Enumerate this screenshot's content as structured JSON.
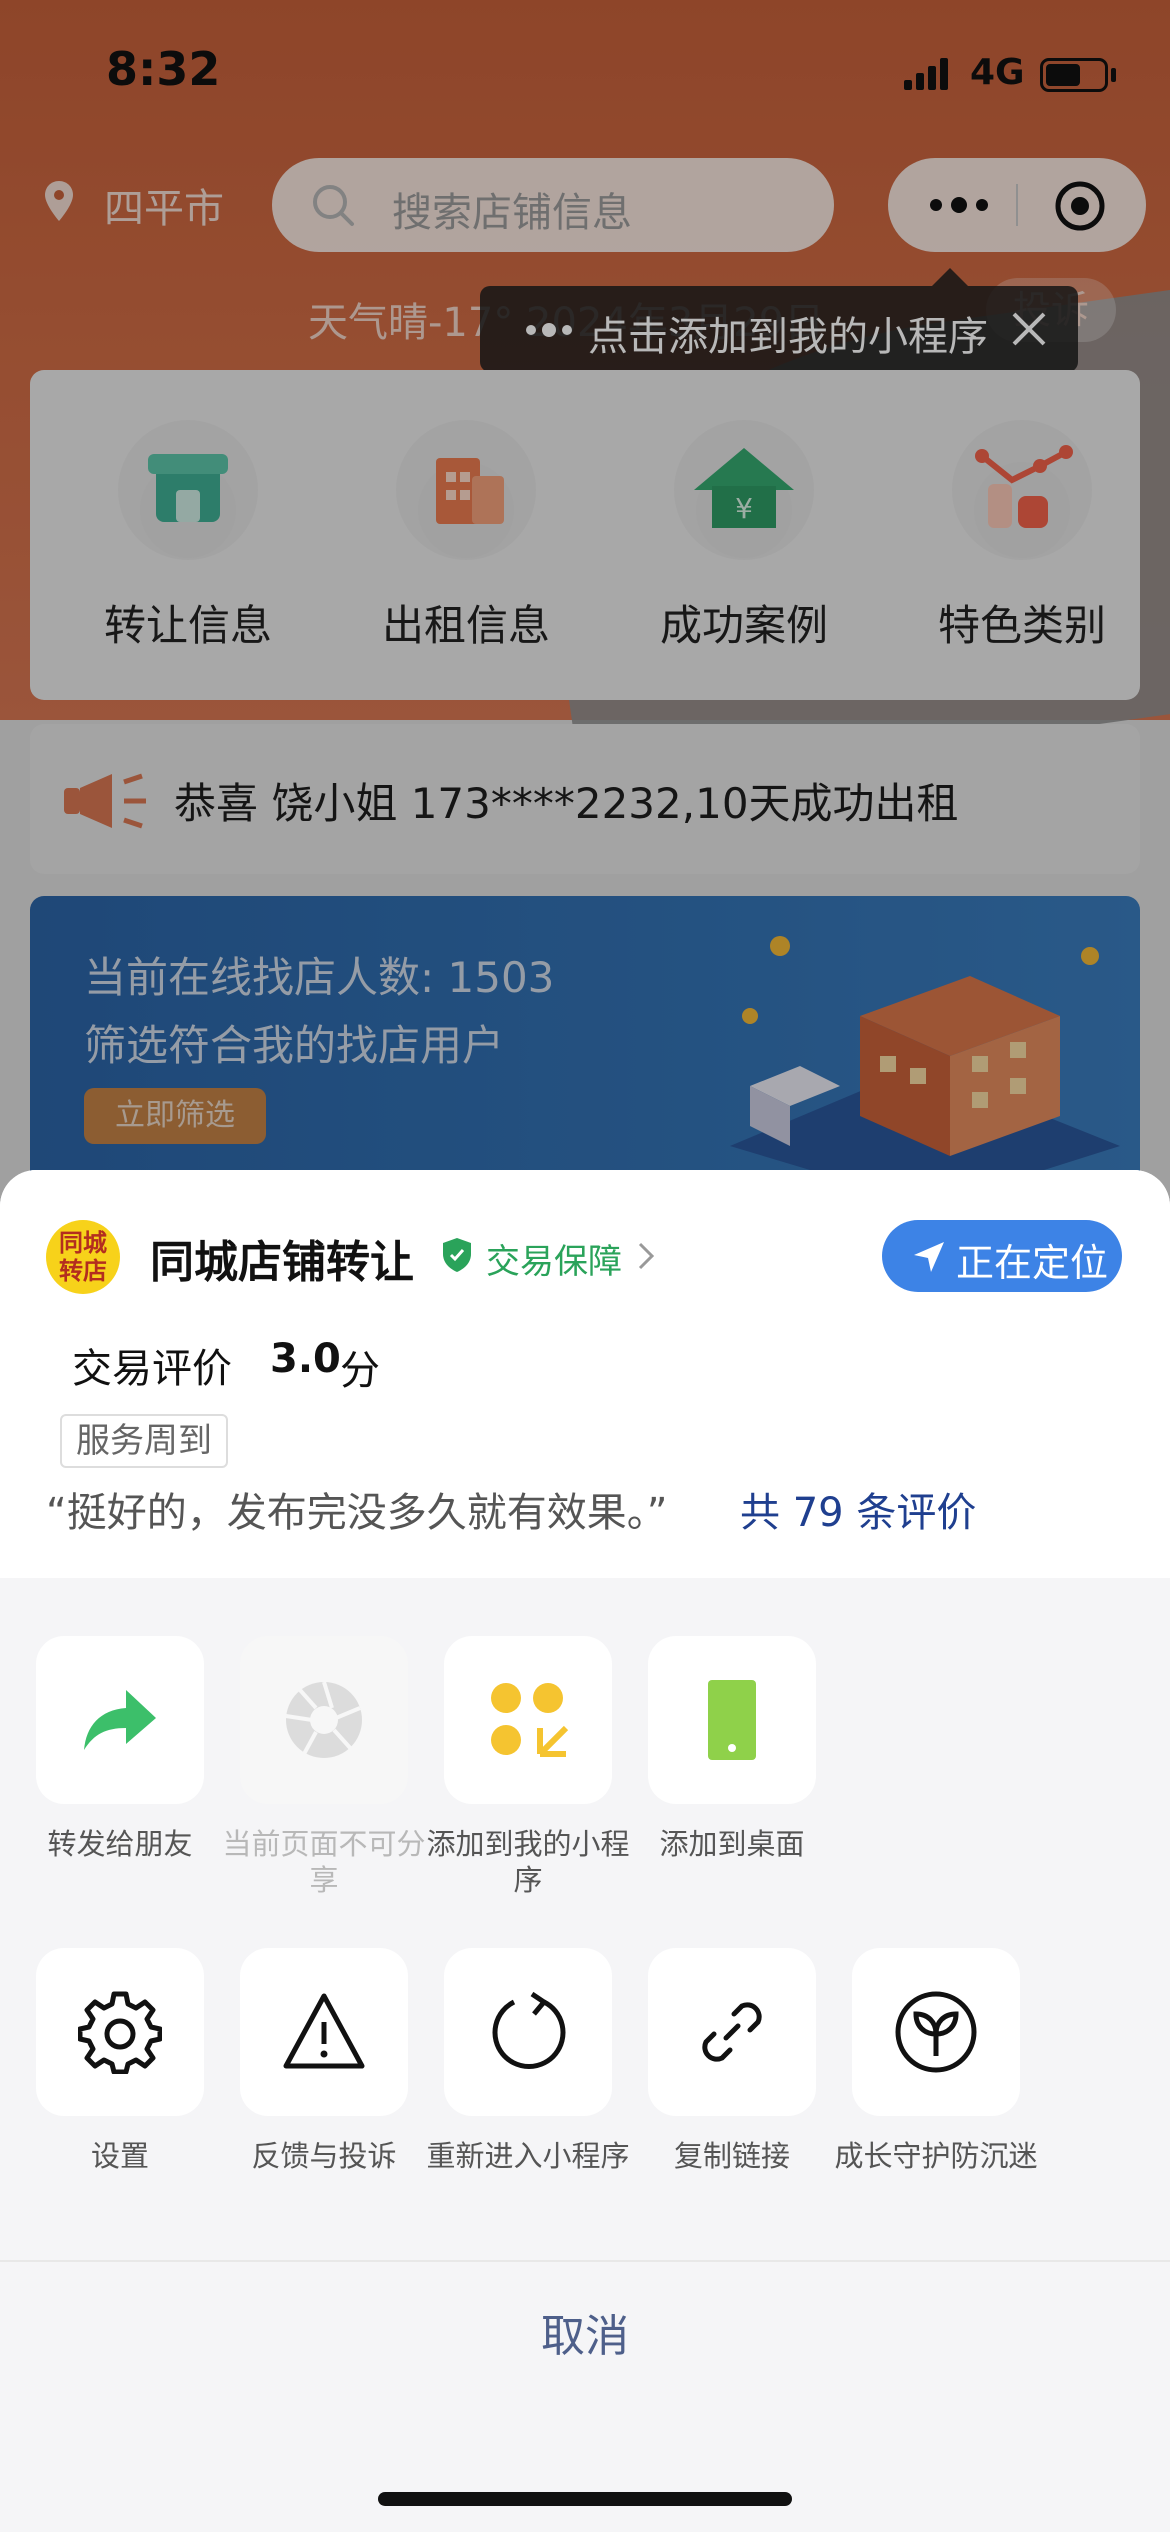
{
  "status": {
    "time": "8:32",
    "network": "4G"
  },
  "header": {
    "city": "四平市",
    "search_placeholder": "搜索店铺信息",
    "weather": "天气晴-17° 2024年3月29日",
    "complaint": "投诉"
  },
  "tooltip": {
    "text": "点击添加到我的小程序"
  },
  "categories": [
    {
      "label": "转让信息",
      "icon": "storefront-icon",
      "color": "#3fae93"
    },
    {
      "label": "出租信息",
      "icon": "building-icon",
      "color": "#e97b4f"
    },
    {
      "label": "成功案例",
      "icon": "house-yuan-icon",
      "color": "#35a86f"
    },
    {
      "label": "特色类别",
      "icon": "trend-chart-icon",
      "color": "#f0614a"
    }
  ],
  "news": {
    "text": "恭喜 饶小姐 173****2232,10天成功出租"
  },
  "banner": {
    "title": "当前在线找店人数: 1503",
    "subtitle": "筛选符合我的找店用户",
    "button": "立即筛选"
  },
  "sheet": {
    "logo_line1": "同城",
    "logo_line2": "转店",
    "app_name": "同城店铺转让",
    "guarantee": "交易保障",
    "locate_button": "正在定位",
    "rating_label": "交易评价",
    "rating_value": "3.0",
    "rating_unit": "分",
    "tag": "服务周到",
    "quote": "“挺好的，发布完没多久就有效果。”",
    "review_count": "共 79 条评价"
  },
  "actions_row1": [
    {
      "label": "转发给朋友",
      "icon": "forward-arrow-icon"
    },
    {
      "label": "当前页面不可分享",
      "icon": "aperture-icon",
      "disabled": true
    },
    {
      "label": "添加到我的小程序",
      "icon": "add-miniprogram-icon"
    },
    {
      "label": "添加到桌面",
      "icon": "phone-icon"
    }
  ],
  "actions_row2": [
    {
      "label": "设置",
      "icon": "gear-icon"
    },
    {
      "label": "反馈与投诉",
      "icon": "warning-icon"
    },
    {
      "label": "重新进入小程序",
      "icon": "reload-icon"
    },
    {
      "label": "复制链接",
      "icon": "link-icon"
    },
    {
      "label": "成长守护防沉迷",
      "icon": "sprout-icon"
    }
  ],
  "cancel": "取消",
  "colors": {
    "accent_orange": "#cf6b44",
    "locate_blue": "#3d83e6",
    "guarantee_green": "#2aa35a",
    "share_green": "#3cbf6a",
    "yellow": "#f5c430",
    "lime": "#8fd14a"
  }
}
